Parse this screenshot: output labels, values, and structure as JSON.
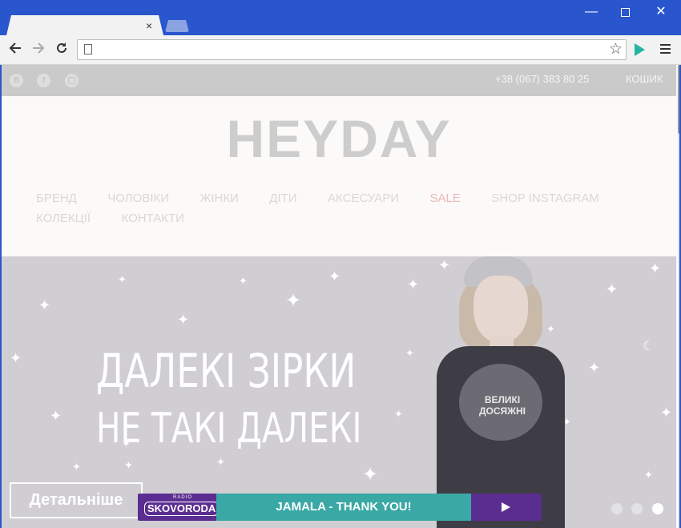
{
  "browser": {
    "tab_title": "",
    "tab_close": "×",
    "address": "",
    "window_controls": {
      "minimize": "—",
      "close": "✕"
    },
    "icons": [
      "back-icon",
      "forward-icon",
      "reload-icon",
      "page-icon",
      "star-icon",
      "extension-icon",
      "menu-icon"
    ]
  },
  "site": {
    "social": [
      {
        "name": "vk",
        "glyph": "B"
      },
      {
        "name": "facebook",
        "glyph": "f"
      }
    ],
    "phone": "+38 (067) 383 80 25",
    "cart": "КОШИК",
    "logo": "HEYDAY",
    "menu": [
      {
        "label": "БРЕНД"
      },
      {
        "label": "ЧОЛОВІКИ"
      },
      {
        "label": "ЖІНКИ"
      },
      {
        "label": "ДІТИ"
      },
      {
        "label": "АКСЕСУАРИ"
      },
      {
        "label": "SALE"
      },
      {
        "label": "SHOP INSTAGRAM"
      },
      {
        "label": "КОЛЕКЦІЇ"
      },
      {
        "label": "КОНТАКТИ"
      }
    ],
    "colors": {
      "sale": "#e8b8b8",
      "player_teal": "#3aa8a5",
      "player_purple": "#5b2d91"
    }
  },
  "hero": {
    "line1": "ДАЛЕКІ ЗІРКИ",
    "line2": "НЕ ТАКІ ДАЛЕКІ",
    "print_line1": "ВЕЛИКІ",
    "print_line2": "ДОСЯЖНІ",
    "cta": "Детальніше",
    "slides_total": 3,
    "slide_active": 3
  },
  "player": {
    "radio_small": "RADIO",
    "station": "SKOVORODA",
    "track": "JAMALA - THANK YOU!"
  }
}
